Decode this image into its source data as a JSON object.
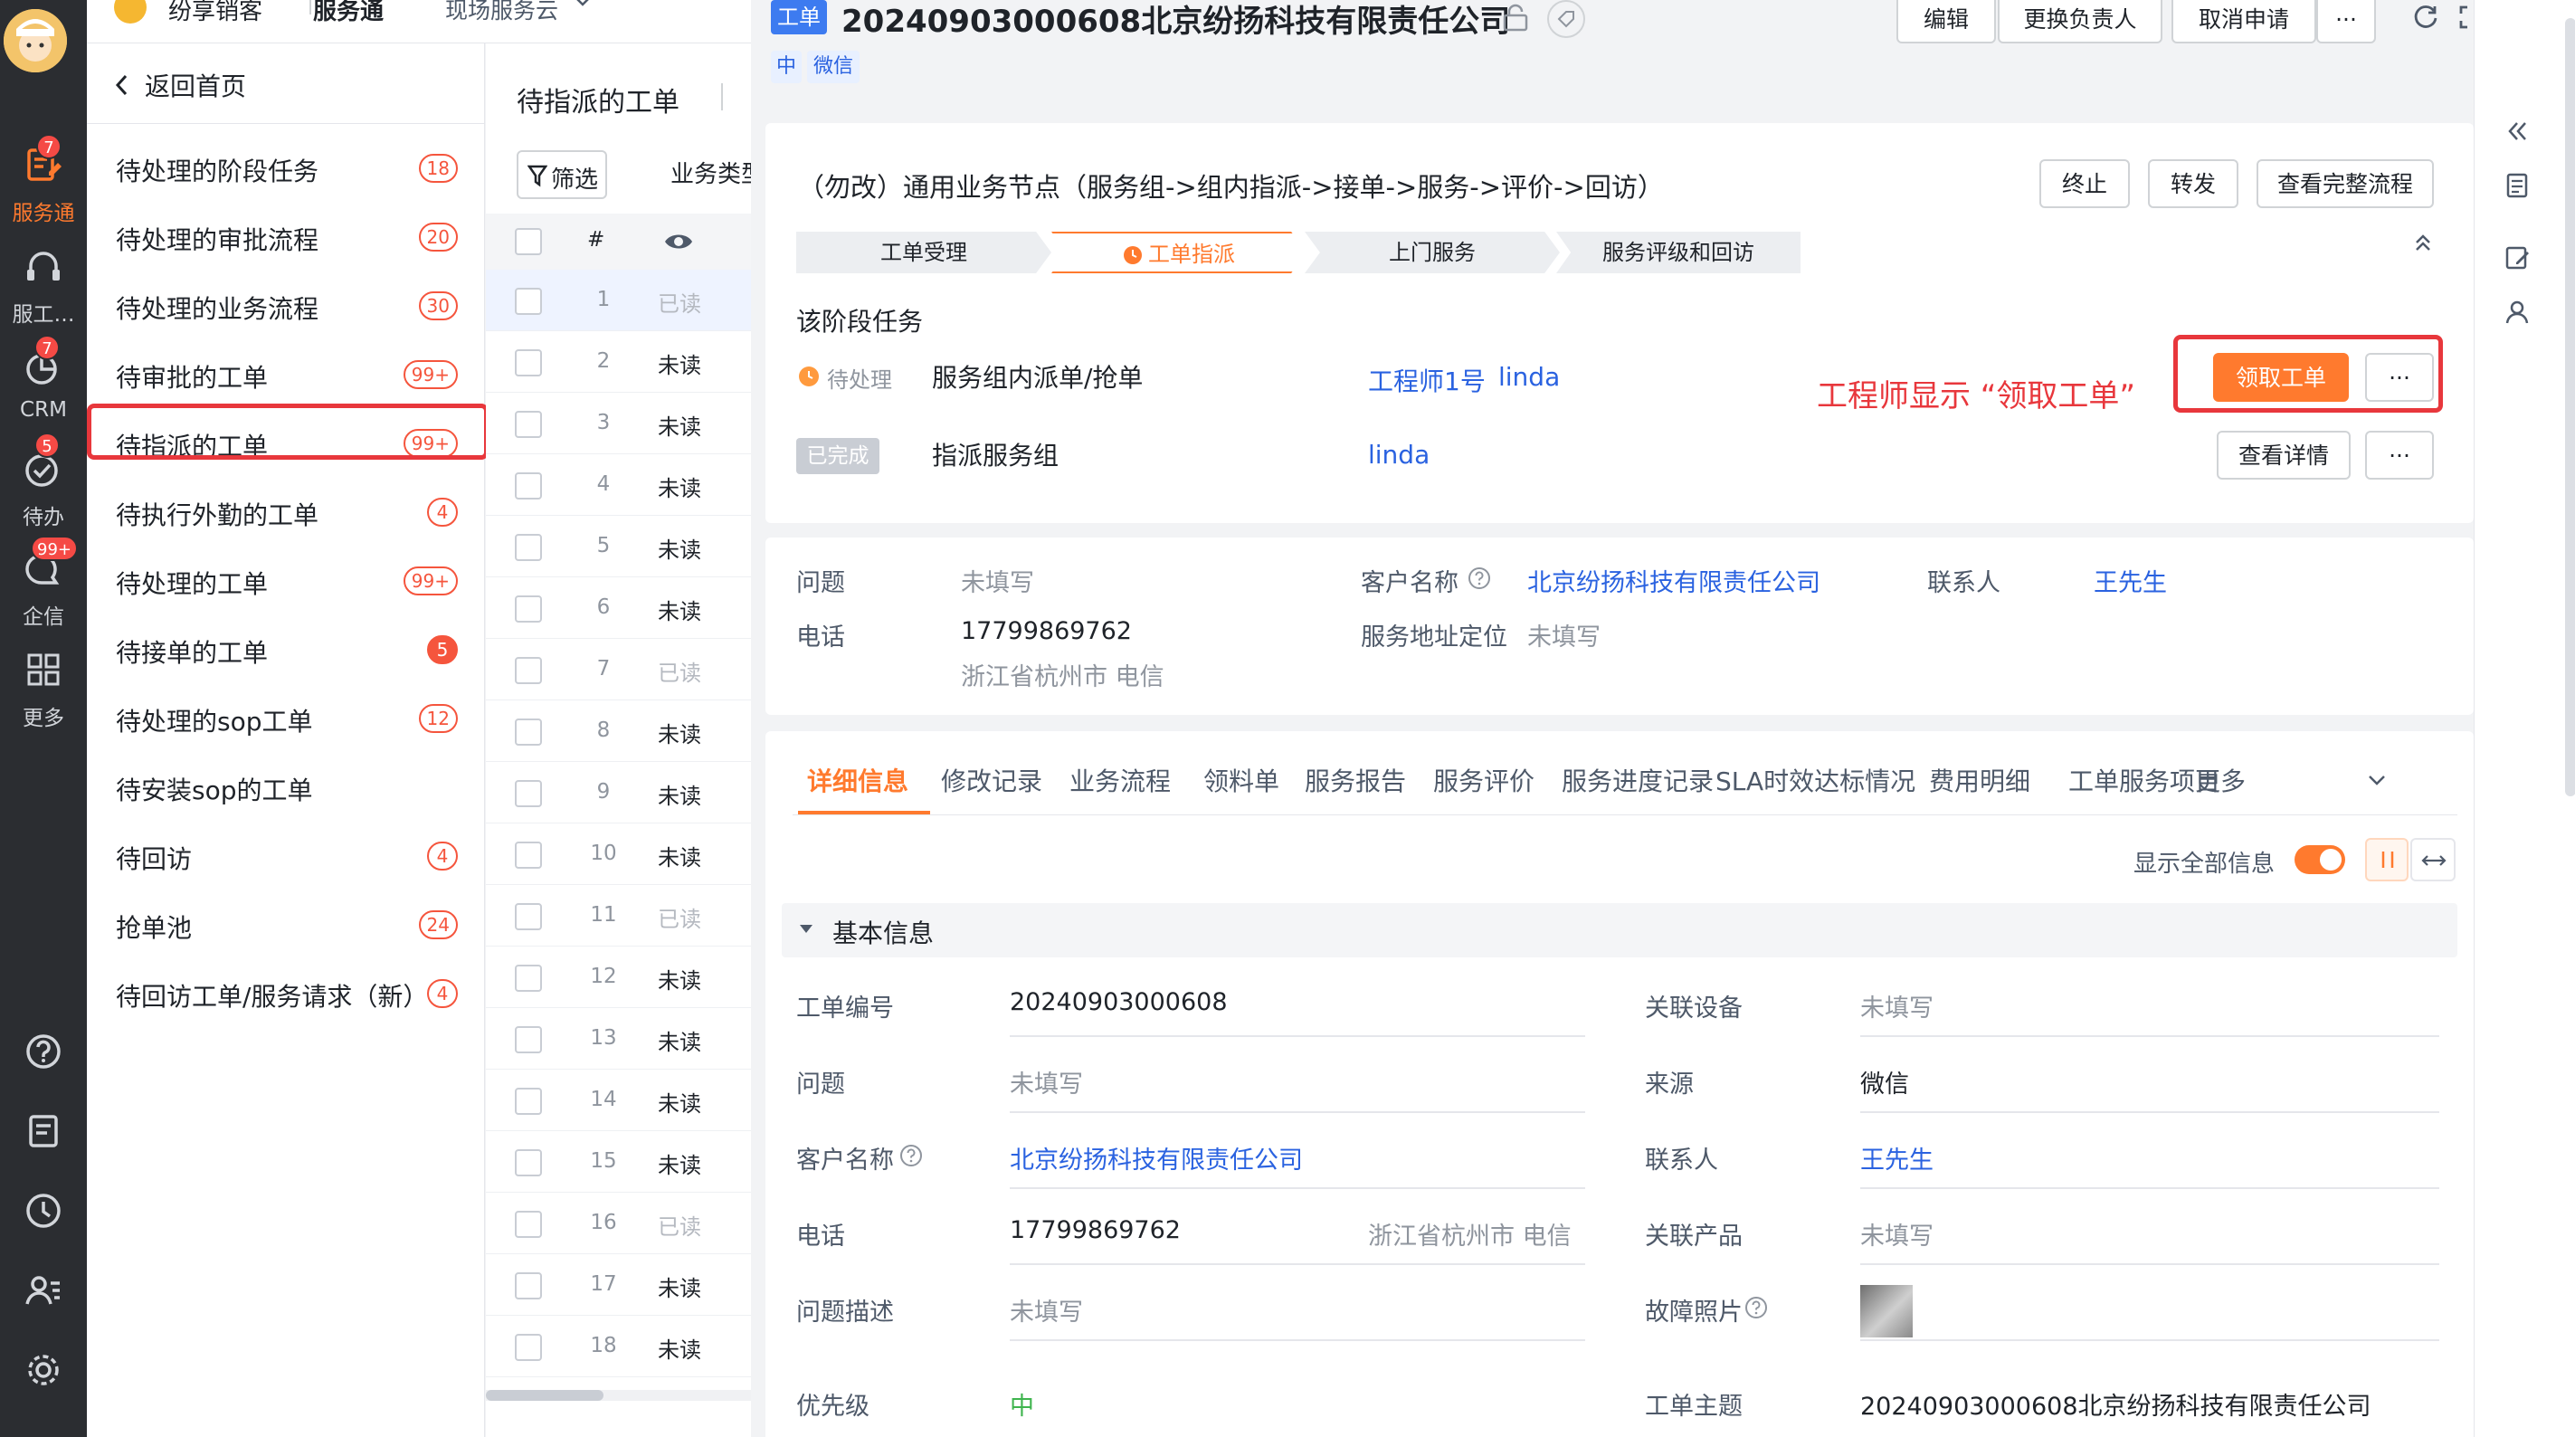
{
  "rail": {
    "items": [
      {
        "label": "服务通",
        "badge": "7"
      },
      {
        "label": "服工…",
        "badge": ""
      },
      {
        "label": "CRM",
        "badge": "7"
      },
      {
        "label": "待办",
        "badge": "5"
      },
      {
        "label": "企信",
        "badge": "99+"
      },
      {
        "label": "更多",
        "badge": ""
      }
    ]
  },
  "topbar": {
    "app": "纷享销客",
    "module": "服务通",
    "scope": "现场服务云"
  },
  "nav": {
    "back": "返回首页",
    "items": [
      {
        "label": "待处理的阶段任务",
        "badge": "18"
      },
      {
        "label": "待处理的审批流程",
        "badge": "20"
      },
      {
        "label": "待处理的业务流程",
        "badge": "30"
      },
      {
        "label": "待审批的工单",
        "badge": "99+"
      },
      {
        "label": "待指派的工单",
        "badge": "99+"
      },
      {
        "label": "待执行外勤的工单",
        "badge": "4"
      },
      {
        "label": "待处理的工单",
        "badge": "99+"
      },
      {
        "label": "待接单的工单",
        "badge": "5"
      },
      {
        "label": "待处理的sop工单",
        "badge": "12"
      },
      {
        "label": "待安装sop的工单",
        "badge": ""
      },
      {
        "label": "待回访",
        "badge": "4"
      },
      {
        "label": "抢单池",
        "badge": "24"
      },
      {
        "label": "待回访工单/服务请求（新）",
        "badge": "4"
      }
    ]
  },
  "list": {
    "title": "待指派的工单",
    "filter": "筛选",
    "biz_type": "业务类型",
    "col_num": "#",
    "rows": [
      {
        "n": "1",
        "s": "已读"
      },
      {
        "n": "2",
        "s": "未读"
      },
      {
        "n": "3",
        "s": "未读"
      },
      {
        "n": "4",
        "s": "未读"
      },
      {
        "n": "5",
        "s": "未读"
      },
      {
        "n": "6",
        "s": "未读"
      },
      {
        "n": "7",
        "s": "已读"
      },
      {
        "n": "8",
        "s": "未读"
      },
      {
        "n": "9",
        "s": "未读"
      },
      {
        "n": "10",
        "s": "未读"
      },
      {
        "n": "11",
        "s": "已读"
      },
      {
        "n": "12",
        "s": "未读"
      },
      {
        "n": "13",
        "s": "未读"
      },
      {
        "n": "14",
        "s": "未读"
      },
      {
        "n": "15",
        "s": "未读"
      },
      {
        "n": "16",
        "s": "已读"
      },
      {
        "n": "17",
        "s": "未读"
      },
      {
        "n": "18",
        "s": "未读"
      }
    ]
  },
  "detail": {
    "tag": "工单",
    "title": "20240903000608北京纷扬科技有限责任公司",
    "tag_priority": "中",
    "tag_source": "微信",
    "buttons": {
      "edit": "编辑",
      "change_owner": "更换负责人",
      "cancel": "取消申请",
      "more": "···"
    },
    "flow": {
      "title": "（勿改）通用业务节点（服务组->组内指派->接单->服务->评价->回访）",
      "terminate": "终止",
      "forward": "转发",
      "view_full": "查看完整流程",
      "steps": [
        "工单受理",
        "工单指派",
        "上门服务",
        "服务评级和回访"
      ],
      "stage_title": "该阶段任务",
      "tasks": [
        {
          "status": "待处理",
          "name": "服务组内派单/抢单",
          "assignee1": "工程师1号",
          "assignee2": "linda",
          "action": "领取工单",
          "more": "···"
        },
        {
          "status": "已完成",
          "name": "指派服务组",
          "assignee1": "linda",
          "assignee2": "",
          "action": "查看详情",
          "more": "···"
        }
      ],
      "annotation": "工程师显示 “领取工单”"
    },
    "summary": {
      "question_label": "问题",
      "question_value": "未填写",
      "customer_label": "客户名称",
      "customer_value": "北京纷扬科技有限责任公司",
      "contact_label": "联系人",
      "contact_value": "王先生",
      "phone_label": "电话",
      "phone_value": "17799869762",
      "phone_region": "浙江省杭州市 电信",
      "addr_label": "服务地址定位",
      "addr_value": "未填写"
    },
    "tabs": [
      "详细信息",
      "修改记录",
      "业务流程",
      "领料单",
      "服务报告",
      "服务评价",
      "服务进度记录",
      "SLA时效达标情况",
      "费用明细",
      "工单服务项目",
      "更多"
    ],
    "show_all": "显示全部信息",
    "section": "基本信息",
    "fields_left": [
      {
        "label": "工单编号",
        "value": "20240903000608",
        "extra": ""
      },
      {
        "label": "问题",
        "value": "未填写",
        "extra": ""
      },
      {
        "label": "客户名称",
        "value": "北京纷扬科技有限责任公司",
        "extra": ""
      },
      {
        "label": "电话",
        "value": "17799869762",
        "extra": "浙江省杭州市 电信"
      },
      {
        "label": "问题描述",
        "value": "未填写",
        "extra": ""
      },
      {
        "label": "优先级",
        "value": "中",
        "extra": ""
      }
    ],
    "fields_right": [
      {
        "label": "关联设备",
        "value": "未填写"
      },
      {
        "label": "来源",
        "value": "微信"
      },
      {
        "label": "联系人",
        "value": "王先生"
      },
      {
        "label": "关联产品",
        "value": "未填写"
      },
      {
        "label": "故障照片",
        "value": ""
      },
      {
        "label": "工单主题",
        "value": "20240903000608北京纷扬科技有限责任公司"
      }
    ]
  },
  "colors": {
    "accent": "#ff7a2e",
    "link": "#2a62e0",
    "danger": "#f54a45",
    "highlight": "#e8373c"
  }
}
